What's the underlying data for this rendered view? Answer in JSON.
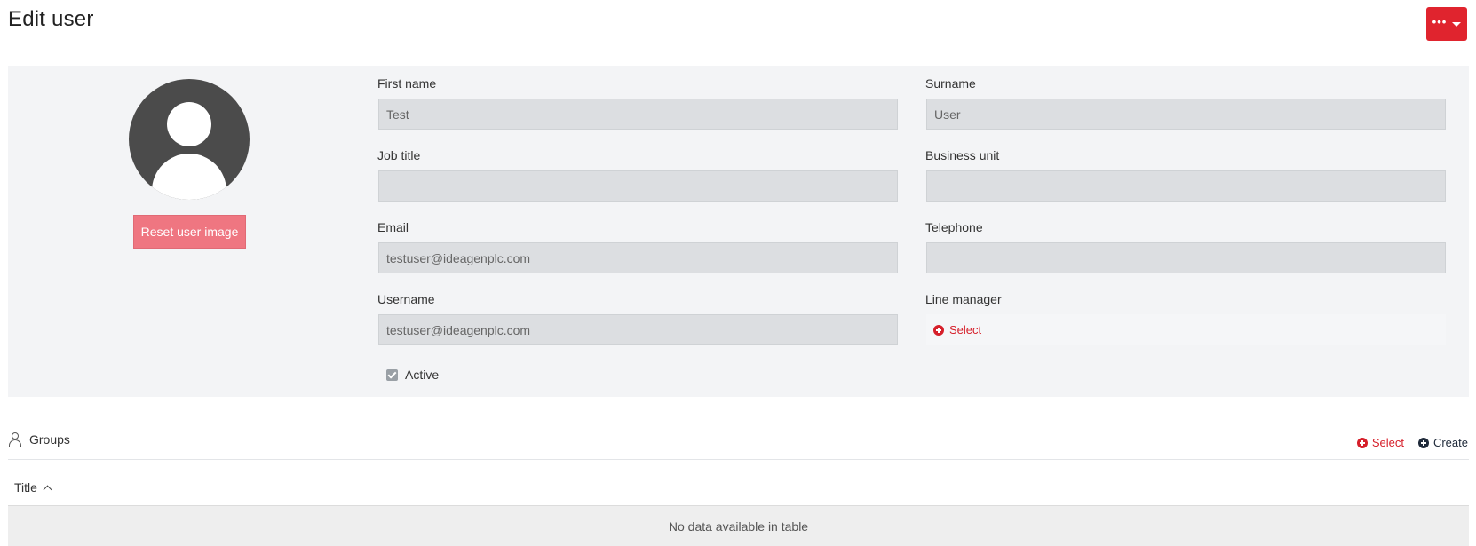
{
  "header": {
    "title": "Edit user",
    "actions_dots": "•••"
  },
  "profile": {
    "reset_image_label": "Reset user image"
  },
  "form": {
    "first_name": {
      "label": "First name",
      "value": "Test"
    },
    "surname": {
      "label": "Surname",
      "value": "User"
    },
    "job_title": {
      "label": "Job title",
      "value": ""
    },
    "business_unit": {
      "label": "Business unit",
      "value": ""
    },
    "email": {
      "label": "Email",
      "value": "testuser@ideagenplc.com"
    },
    "telephone": {
      "label": "Telephone",
      "value": ""
    },
    "username": {
      "label": "Username",
      "value": "testuser@ideagenplc.com"
    },
    "line_manager": {
      "label": "Line manager",
      "select_label": "Select"
    },
    "active": {
      "label": "Active",
      "checked": true
    }
  },
  "groups": {
    "title": "Groups",
    "select_label": "Select",
    "create_label": "Create",
    "table": {
      "columns": [
        "Title"
      ],
      "empty_text": "No data available in table"
    }
  },
  "colors": {
    "accent": "#e0242e",
    "reset_button": "#ef7681",
    "panel_bg": "#f3f4f6",
    "input_bg": "#dcdee1"
  }
}
